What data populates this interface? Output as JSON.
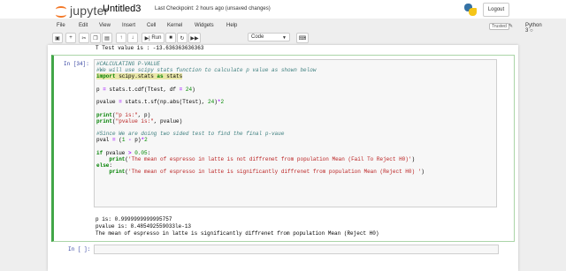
{
  "header": {
    "logo_text": "jupyter",
    "notebook_title": "Untitled3",
    "checkpoint": "Last Checkpoint: 2 hours ago",
    "unsaved": "(unsaved changes)",
    "logout_label": "Logout"
  },
  "menu": {
    "items": [
      "File",
      "Edit",
      "View",
      "Insert",
      "Cell",
      "Kernel",
      "Widgets",
      "Help"
    ],
    "trusted_label": "Trusted",
    "kernel_indicator": "✎",
    "kernel_name": "Python 3"
  },
  "toolbar": {
    "save_icon": "save-icon",
    "add_icon": "plus-icon",
    "cut_icon": "scissors-icon",
    "copy_icon": "copy-icon",
    "paste_icon": "paste-icon",
    "up_icon": "arrow-up-icon",
    "down_icon": "arrow-down-icon",
    "run_label": "Run",
    "run_icon": "step-forward-icon",
    "stop_icon": "stop-icon",
    "restart_icon": "restart-icon",
    "restart_run_icon": "fast-forward-icon",
    "cell_type": "Code",
    "keyboard_icon": "keyboard-icon"
  },
  "notebook": {
    "prev_output": "T Test value is : -13.636363636363",
    "active_prompt": "In [34]:",
    "code": [
      "#CALCULATING P-VALUE",
      "#We will use scipy stats function to calculate p value as shown below",
      "import scipy.stats as stats",
      "",
      "p = stats.t.cdf(Ttest, df = 24)",
      "",
      "pvalue = stats.t.sf(np.abs(Ttest), 24)*2",
      "",
      "print(\"p is:\", p)",
      "print(\"pvalue is:\", pvalue)",
      "",
      "#Since We are doing two sided test to find the final p-vaue",
      "pval = (1 - p)*2",
      "",
      "if pvalue > 0.05:",
      "    print('The mean of espresso in latte is not diffrenet from population Mean (Fail To Reject H0)')",
      "else:",
      "    print('The mean of espresso in latte is significantly diffrenet from population Mean (Reject H0) ')"
    ],
    "output": [
      "p is: 0.9999999999995757",
      "pvalue is: 8.485492559033le-13",
      "The mean of espresso in latte is significantly diffrenet from population Mean (Reject H0)"
    ],
    "empty_prompt": "In [ ]:"
  }
}
